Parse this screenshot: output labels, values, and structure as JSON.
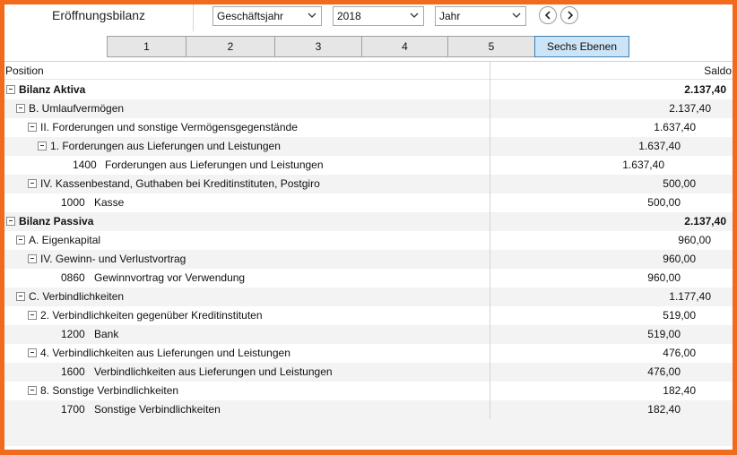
{
  "header": {
    "title": "Eröffnungsbilanz",
    "period_type": "Geschäftsjahr",
    "year": "2018",
    "granularity": "Jahr"
  },
  "levels": [
    "1",
    "2",
    "3",
    "4",
    "5",
    "Sechs Ebenen"
  ],
  "active_level": "Sechs Ebenen",
  "columns": {
    "position": "Position",
    "saldo": "Saldo"
  },
  "rows": [
    {
      "label": "Bilanz Aktiva",
      "saldo": "2.137,40",
      "bold": true
    },
    {
      "label": "B. Umlaufvermögen",
      "saldo": "2.137,40"
    },
    {
      "label": "II. Forderungen und sonstige Vermögensgegenstände",
      "saldo": "1.637,40"
    },
    {
      "label": "1. Forderungen aus Lieferungen und Leistungen",
      "saldo": "1.637,40"
    },
    {
      "account": "1400",
      "label": "Forderungen aus Lieferungen und Leistungen",
      "saldo": "1.637,40"
    },
    {
      "label": "IV. Kassenbestand, Guthaben bei Kreditinstituten, Postgiro",
      "saldo": "500,00"
    },
    {
      "account": "1000",
      "label": "Kasse",
      "saldo": "500,00"
    },
    {
      "label": "Bilanz Passiva",
      "saldo": "2.137,40",
      "bold": true
    },
    {
      "label": "A. Eigenkapital",
      "saldo": "960,00"
    },
    {
      "label": "IV. Gewinn- und Verlustvortrag",
      "saldo": "960,00"
    },
    {
      "account": "0860",
      "label": "Gewinnvortrag vor Verwendung",
      "saldo": "960,00"
    },
    {
      "label": "C. Verbindlichkeiten",
      "saldo": "1.177,40"
    },
    {
      "label": "2. Verbindlichkeiten gegenüber Kreditinstituten",
      "saldo": "519,00"
    },
    {
      "account": "1200",
      "label": "Bank",
      "saldo": "519,00"
    },
    {
      "label": "4. Verbindlichkeiten aus Lieferungen und Leistungen",
      "saldo": "476,00"
    },
    {
      "account": "1600",
      "label": "Verbindlichkeiten aus Lieferungen und Leistungen",
      "saldo": "476,00"
    },
    {
      "label": "8. Sonstige Verbindlichkeiten",
      "saldo": "182,40"
    },
    {
      "account": "1700",
      "label": "Sonstige Verbindlichkeiten",
      "saldo": "182,40"
    }
  ],
  "icons": {
    "dropdown": "chevron-down-icon",
    "prev": "chevron-left-icon",
    "next": "chevron-right-icon",
    "tree_toggle": "collapse-minus-icon"
  },
  "colors": {
    "frame": "#f26a1b",
    "active_level_bg": "#cce4f7",
    "active_level_border": "#3c7fb1",
    "row_alt": "#f3f3f3"
  }
}
